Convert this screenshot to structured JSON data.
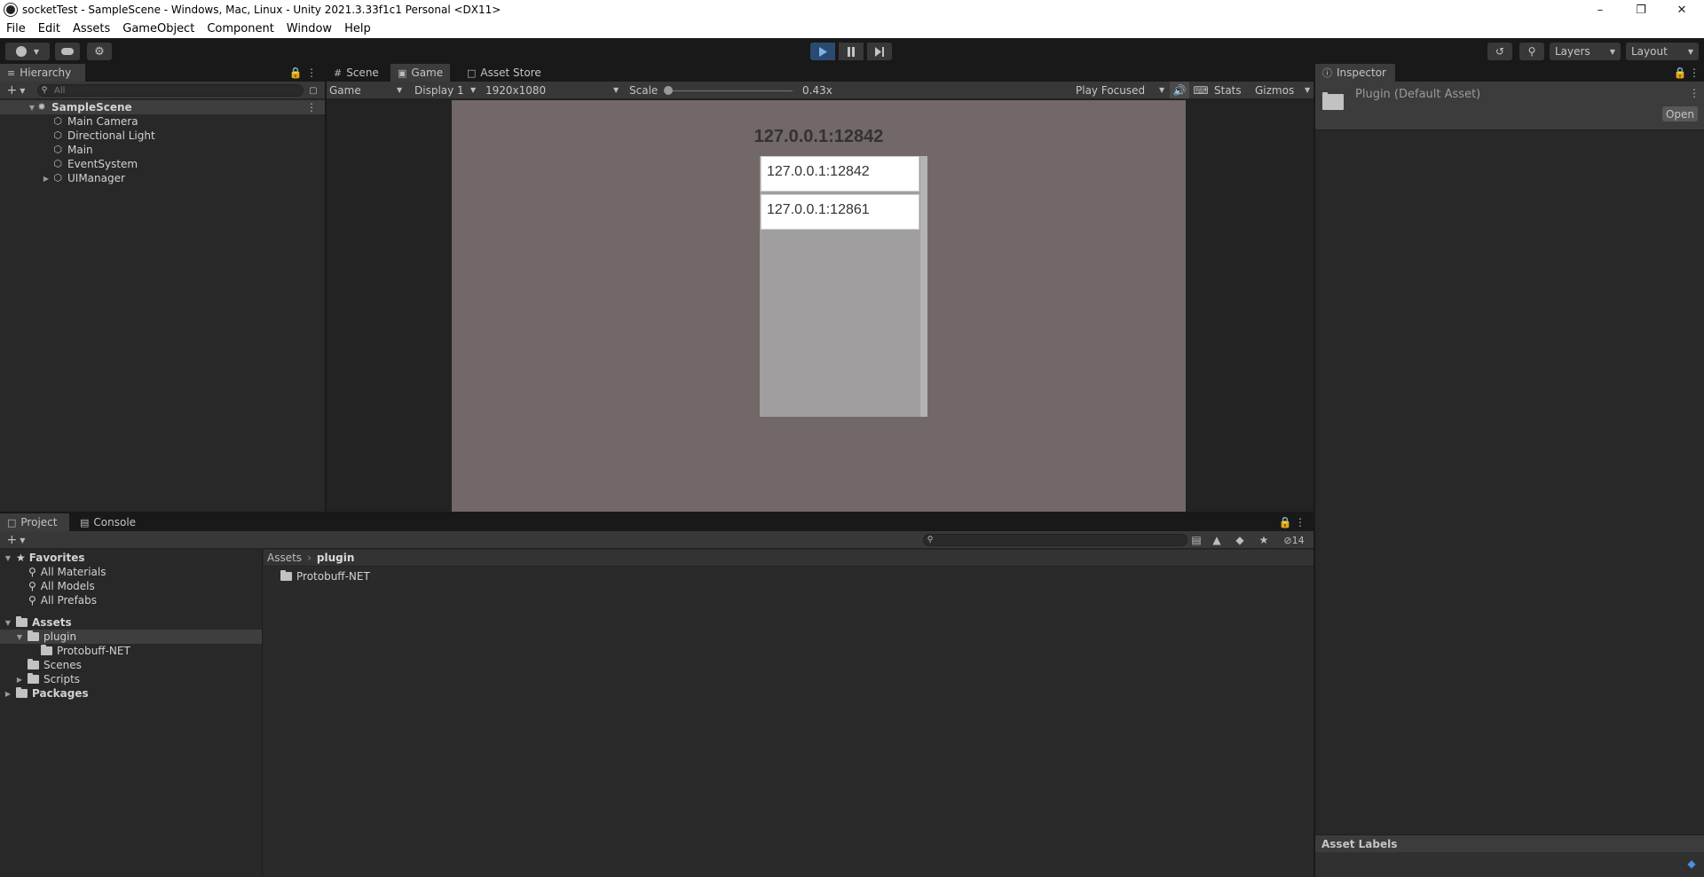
{
  "window": {
    "title": "socketTest - SampleScene - Windows, Mac, Linux - Unity 2021.3.33f1c1 Personal <DX11>"
  },
  "menu": [
    "File",
    "Edit",
    "Assets",
    "GameObject",
    "Component",
    "Window",
    "Help"
  ],
  "toolbar": {
    "layers_label": "Layers",
    "layout_label": "Layout"
  },
  "hierarchy": {
    "tab_label": "Hierarchy",
    "search_placeholder": "All",
    "scene_name": "SampleScene",
    "items": [
      "Main Camera",
      "Directional Light",
      "Main",
      "EventSystem",
      "UIManager"
    ]
  },
  "center_tabs": {
    "scene": "Scene",
    "game": "Game",
    "asset_store": "Asset Store"
  },
  "game_bar": {
    "view_select": "Game",
    "display_select": "Display 1",
    "resolution_select": "1920x1080",
    "scale_label": "Scale",
    "scale_value": "0.43x",
    "play_mode": "Play Focused",
    "stats_label": "Stats",
    "gizmos_label": "Gizmos"
  },
  "game_view": {
    "header_text": "127.0.0.1:12842",
    "list_items": [
      "127.0.0.1:12842",
      "127.0.0.1:12861"
    ],
    "colors": {
      "background": "#726868",
      "list_panel": "#a09e9e",
      "list_item": "#ffffff"
    }
  },
  "inspector": {
    "tab_label": "Inspector",
    "asset_name": "Plugin (Default Asset)",
    "open_button": "Open",
    "asset_labels": "Asset Labels"
  },
  "bottom_tabs": {
    "project": "Project",
    "console": "Console"
  },
  "project": {
    "hidden_count": "14",
    "favorites": {
      "label": "Favorites",
      "items": [
        "All Materials",
        "All Models",
        "All Prefabs"
      ]
    },
    "assets_label": "Assets",
    "tree": {
      "plugin": "plugin",
      "protobuff": "Protobuff-NET",
      "scenes": "Scenes",
      "scripts": "Scripts",
      "packages": "Packages"
    },
    "breadcrumb": [
      "Assets",
      "plugin"
    ],
    "content_items": [
      "Protobuff-NET"
    ]
  },
  "colors": {
    "play_active": "#2b4a70",
    "selected_row": "#2c5d87",
    "panel_bg": "#282828",
    "tab_active": "#3c3c3c"
  }
}
